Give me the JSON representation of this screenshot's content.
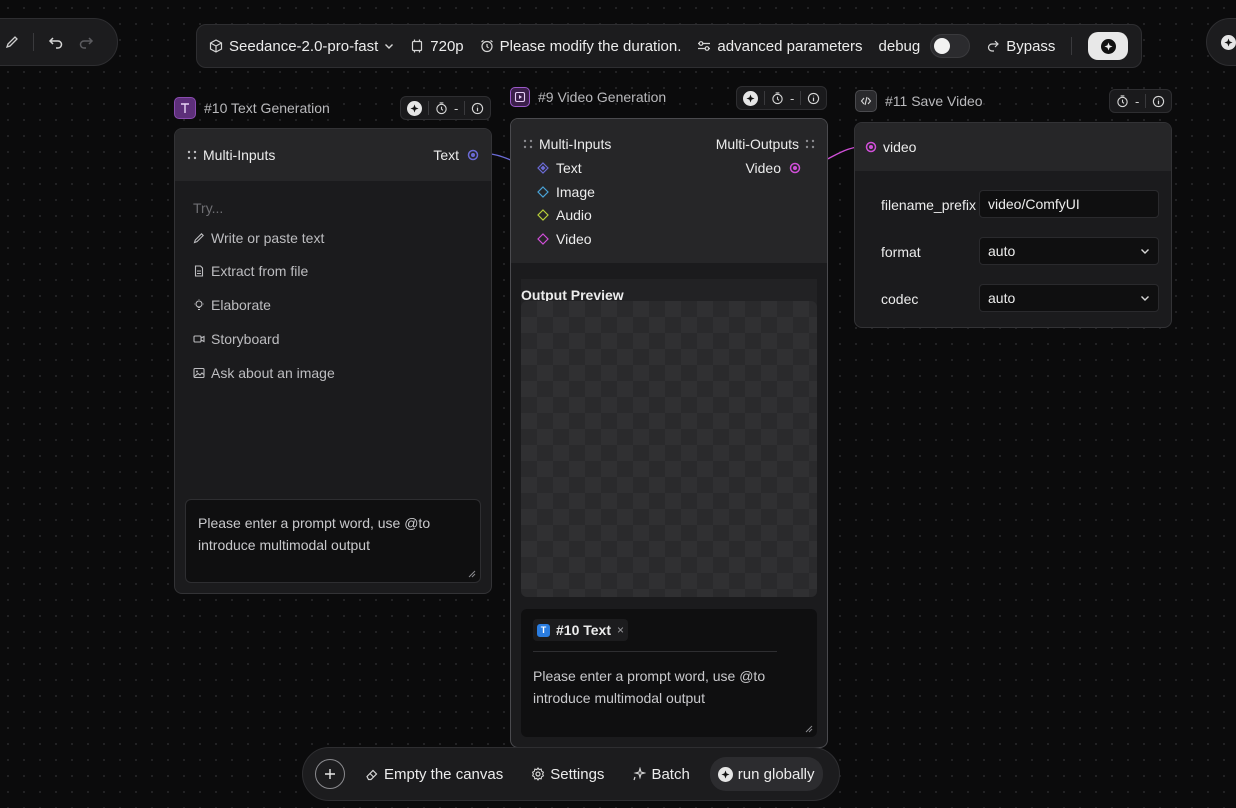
{
  "top_toolbar": {
    "model": "Seedance-2.0-pro-fast",
    "resolution": "720p",
    "duration_hint": "Please modify the duration.",
    "advanced": "advanced parameters",
    "debug_label": "debug",
    "debug_enabled": false,
    "bypass": "Bypass"
  },
  "nodes": {
    "text_generation": {
      "title": "#10 Text Generation",
      "timer": "-",
      "inputs_label": "Multi-Inputs",
      "output_port": "Text",
      "try_placeholder": "Try...",
      "suggestions": [
        {
          "label": "Write or paste text",
          "icon": "pencil-icon"
        },
        {
          "label": "Extract from file",
          "icon": "file-icon"
        },
        {
          "label": "Elaborate",
          "icon": "bulb-icon"
        },
        {
          "label": "Storyboard",
          "icon": "video-camera-icon"
        },
        {
          "label": "Ask about an image",
          "icon": "image-icon"
        }
      ],
      "prompt_placeholder": "Please enter a prompt word, use @to introduce multimodal output",
      "prompt_line1": "Please enter a prompt word, use @to",
      "prompt_line2": "introduce multimodal output"
    },
    "video_generation": {
      "title": "#9 Video Generation",
      "timer": "-",
      "inputs_label": "Multi-Inputs",
      "outputs_label": "Multi-Outputs",
      "input_ports": [
        "Text",
        "Image",
        "Audio",
        "Video"
      ],
      "output_port": "Video",
      "preview_label": "Output Preview",
      "chip_label": "#10 Text",
      "chip_badge": "T",
      "chip_close": "×",
      "prompt_line1": "Please enter a prompt word, use @to",
      "prompt_line2": "introduce multimodal output"
    },
    "save_video": {
      "title": "#11 Save Video",
      "timer": "-",
      "input_port": "video",
      "fields": {
        "filename_prefix_label": "filename_prefix",
        "filename_prefix_value": "video/ComfyUI",
        "format_label": "format",
        "format_value": "auto",
        "codec_label": "codec",
        "codec_value": "auto"
      }
    }
  },
  "bottom_bar": {
    "empty": "Empty the canvas",
    "settings": "Settings",
    "batch": "Batch",
    "run": "run globally"
  },
  "colors": {
    "text_port": "#6b6bd6",
    "video_port": "#d04fd8",
    "image_port": "#4aa3d8",
    "audio_port": "#b8cf3a",
    "text_badge": "#6b3a8c"
  }
}
